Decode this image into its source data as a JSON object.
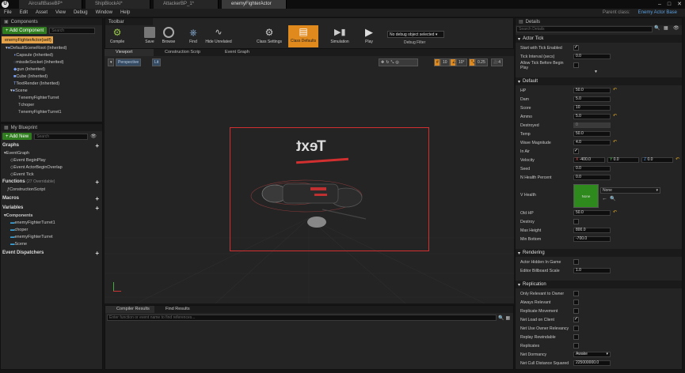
{
  "tabs": [
    "AircraftBaseBP*",
    "ShipBlockAI*",
    "AttackerBP_1*",
    "enemyFighterActor"
  ],
  "parent_class_label": "Parent class:",
  "parent_class_value": "Enemy Actor Base",
  "menu": [
    "File",
    "Edit",
    "Asset",
    "View",
    "Debug",
    "Window",
    "Help"
  ],
  "components": {
    "title": "Components",
    "add_label": "+ Add Component",
    "search_placeholder": "Search",
    "root_label": "enemyFighterActor(self)",
    "items": [
      "DefaultSceneRoot (Inherited)",
      "Capsule (Inherited)",
      "missileSocket (Inherited)",
      "gun (Inherited)",
      "Cube (Inherited)",
      "TextRender (Inherited)",
      "Scene",
      "enemyFighterTurret",
      "choper",
      "enemyFighterTurret1"
    ]
  },
  "blueprint": {
    "title": "My Blueprint",
    "add_label": "+ Add New",
    "search_placeholder": "Search",
    "graphs_label": "Graphs",
    "event_graph": "EventGraph",
    "events": [
      "Event BeginPlay",
      "Event ActorBeginOverlap",
      "Event Tick"
    ],
    "functions_label": "Functions",
    "functions_count": "(27 Overridable)",
    "functions": [
      "ConstructionScript"
    ],
    "macros_label": "Macros",
    "variables_label": "Variables",
    "components_label": "Components",
    "component_vars": [
      "enemyFighterTurret1",
      "choper",
      "enemyFighterTurret",
      "Scene"
    ],
    "dispatchers_label": "Event Dispatchers"
  },
  "toolbar": {
    "title": "Toolbar",
    "buttons": [
      "Compile",
      "Save",
      "Browse",
      "Find",
      "Hide Unrelated",
      "Class Settings",
      "Class Defaults",
      "Simulation",
      "Play"
    ],
    "debug_select": "No debug object selected",
    "debug_filter": "Debug Filter"
  },
  "editor_tabs": [
    "Viewport",
    "Construction Scrip",
    "Event Graph"
  ],
  "viewport": {
    "perspective": "Perspective",
    "lit": "Lit",
    "grid_snap": "10",
    "rot_snap": "10°",
    "scale_snap": "0.25",
    "cam_speed": "4",
    "text_render": "Text"
  },
  "bottom": {
    "tabs": [
      "Compiler Results",
      "Find Results"
    ],
    "search_placeholder": "Enter function or event name to find references..."
  },
  "details": {
    "title": "Details",
    "search_placeholder": "Search Details",
    "actor_tick": {
      "label": "Actor Tick",
      "start_with_tick": "Start with Tick Enabled",
      "tick_interval_label": "Tick Interval (secs)",
      "tick_interval": "0.0",
      "allow_tick": "Allow Tick Before Begin Play"
    },
    "default": {
      "label": "Default",
      "rows": [
        {
          "label": "HP",
          "value": "50.0"
        },
        {
          "label": "Dam",
          "value": "5.0"
        },
        {
          "label": "Score",
          "value": "10"
        },
        {
          "label": "Ammo",
          "value": "5.0"
        },
        {
          "label": "Destroyed",
          "value": "0"
        },
        {
          "label": "Temp",
          "value": "50.0"
        },
        {
          "label": "Wave Magnitude",
          "value": "4.0"
        }
      ],
      "in_air": "In Air",
      "velocity_label": "Velocity",
      "velocity": {
        "x": "-400.0",
        "y": "0.0",
        "z": "0.0"
      },
      "speed_label": "Seed",
      "speed": "0.0",
      "hp_percent_label": "N Health Percent",
      "hp_percent": "0.0",
      "vhealth_label": "V Health",
      "vhealth_swatch": "None",
      "vhealth_select": "None",
      "old_hp_label": "Old HP",
      "old_hp": "50.0",
      "destroy_label": "Destroy",
      "max_height_label": "Max Height",
      "max_height": "800.0",
      "min_bottom_label": "Min Bottom",
      "min_bottom": "-700.0"
    },
    "rendering": {
      "label": "Rendering",
      "hidden_label": "Actor Hidden In Game",
      "billboard_label": "Editor Billboard Scale",
      "billboard": "1.0"
    },
    "replication": {
      "label": "Replication",
      "rows": [
        "Only Relevant to Owner",
        "Always Relevant",
        "Replicate Movement",
        "Net Load on Client",
        "Net Use Owner Relevancy",
        "Replay Rewindable",
        "Replicates"
      ],
      "dormancy_label": "Net Dormancy",
      "dormancy": "Awake",
      "cull_label": "Net Cull Distance Squared",
      "cull": "225000000.0"
    }
  },
  "colors": {
    "accent_orange": "#e08a1e",
    "add_green": "#2f7d1f",
    "selection_red": "#d23030",
    "vhealth_green": "#2f8a1e"
  }
}
